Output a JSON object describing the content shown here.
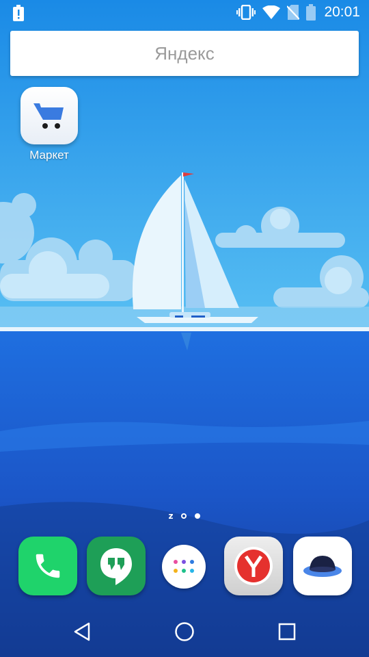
{
  "status_bar": {
    "time": "20:01",
    "icons": [
      "alert-battery-icon",
      "vibrate-icon",
      "wifi-icon",
      "no-sim-icon",
      "battery-icon"
    ]
  },
  "search": {
    "placeholder": "Яндекс"
  },
  "desktop": {
    "shortcuts": [
      {
        "label": "Маркет",
        "icon": "cart-icon"
      }
    ]
  },
  "page_indicator": {
    "z_label": "z",
    "pages": 2,
    "current": 2
  },
  "dock": {
    "apps": [
      {
        "icon": "phone-icon",
        "color": "#1fd36b"
      },
      {
        "icon": "hangouts-icon",
        "color": "#1e9f57"
      },
      {
        "icon": "all-apps-icon",
        "color": "#ffffff"
      },
      {
        "icon": "yandex-browser-icon",
        "color": "#d9d9d9"
      },
      {
        "icon": "yandex-disk-icon",
        "color": "#ffffff"
      }
    ]
  },
  "nav_bar": {
    "buttons": [
      "back-icon",
      "home-icon",
      "recents-icon"
    ]
  }
}
